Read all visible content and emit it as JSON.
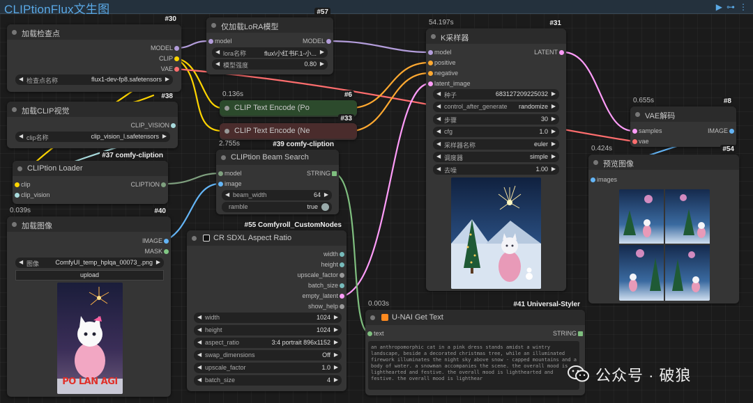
{
  "app": {
    "title": "CLIPtionFlux文生图"
  },
  "colors": {
    "model": "#b39ddb",
    "clip": "#ffd500",
    "vae": "#ff6e6e",
    "latent": "#ff9cf9",
    "image": "#64b5f6",
    "conditioning": "#ffa931",
    "string": "#7fbf7f",
    "clip_vision": "#a8dadc",
    "mask": "#81c784"
  },
  "nodes": {
    "checkpoint": {
      "id": "#30",
      "title": "加载检查点",
      "outputs": [
        "MODEL",
        "CLIP",
        "VAE"
      ],
      "widget_label": "检查点名称",
      "widget_value": "flux1-dev-fp8.safetensors"
    },
    "lora": {
      "id": "#57",
      "title": "仅加载LoRA模型",
      "input": "model",
      "output": "MODEL",
      "lora_label": "lora名称",
      "lora_value": "flux\\小红书F.1-小...",
      "strength_label": "模型强度",
      "strength_value": "0.80"
    },
    "ksampler": {
      "id": "#31",
      "time": "54.197s",
      "title": "K采样器",
      "inputs": [
        "model",
        "positive",
        "negative",
        "latent_image"
      ],
      "output": "LATENT",
      "widgets": [
        {
          "label": "种子",
          "value": "683127209225032"
        },
        {
          "label": "control_after_generate",
          "value": "randomize"
        },
        {
          "label": "步骤",
          "value": "30"
        },
        {
          "label": "cfg",
          "value": "1.0"
        },
        {
          "label": "采样器名称",
          "value": "euler"
        },
        {
          "label": "调度器",
          "value": "simple"
        },
        {
          "label": "去噪",
          "value": "1.00"
        }
      ]
    },
    "clipvision": {
      "id": "#38",
      "title": "加载CLIP视觉",
      "output": "CLIP_VISION",
      "widget_label": "clip名称",
      "widget_value": "clip_vision_l.safetensors"
    },
    "encode_pos": {
      "id": "#6",
      "time": "0.136s",
      "title": "CLIP Text Encode (Po"
    },
    "encode_neg": {
      "id": "#33",
      "title": "CLIP Text Encode (Ne"
    },
    "clipton_loader": {
      "id": "#37 comfy-cliption",
      "title": "CLIPtion Loader",
      "inputs": [
        "clip",
        "clip_vision"
      ],
      "output": "CLIPTION"
    },
    "beam": {
      "id": "#39 comfy-cliption",
      "time": "2.755s",
      "title": "CLIPtion Beam Search",
      "inputs": [
        "model",
        "image"
      ],
      "output": "STRING",
      "beam_label": "beam_width",
      "beam_value": "64",
      "ramble_label": "ramble",
      "ramble_value": "true"
    },
    "vaedecode": {
      "id": "#8",
      "time": "0.655s",
      "title": "VAE解码",
      "inputs": [
        "samples",
        "vae"
      ],
      "output": "IMAGE"
    },
    "preview": {
      "id": "#54",
      "time": "0.424s",
      "title": "预览图像",
      "input": "images"
    },
    "loadimage": {
      "id": "#40",
      "time": "0.039s",
      "title": "加载图像",
      "outputs": [
        "IMAGE",
        "MASK"
      ],
      "widget_label": "图像",
      "widget_value": "ComfyUI_temp_hplqa_00073_.png",
      "upload_label": "upload",
      "poster_text": "PO LAN AGI"
    },
    "aspect": {
      "id": "#55 Comfyroll_CustomNodes",
      "title": "CR SDXL Aspect Ratio",
      "outputs": [
        "width",
        "height",
        "upscale_factor",
        "batch_size",
        "empty_latent",
        "show_help"
      ],
      "widgets": [
        {
          "label": "width",
          "value": "1024"
        },
        {
          "label": "height",
          "value": "1024"
        },
        {
          "label": "aspect_ratio",
          "value": "3:4 portrait 896x1152"
        },
        {
          "label": "swap_dimensions",
          "value": "Off"
        },
        {
          "label": "upscale_factor",
          "value": "1.0"
        },
        {
          "label": "batch_size",
          "value": "4"
        }
      ]
    },
    "gettext": {
      "id": "#41 Universal-Styler",
      "time": "0.003s",
      "title": "U-NAI Get Text",
      "input": "text",
      "output": "STRING",
      "text": "an anthropomorphic cat in a pink dress stands amidst a wintry landscape, beside a decorated christmas tree, while an illuminated firework illuminates the night sky above snow - capped mountains and a body of water. a snowman accompanies the scene. the overall mood is lighthearted and festive. the overall mood is lighthearted and festive. the overall mood is lighthear"
    }
  },
  "watermark": {
    "text": "公众号 · 破狼",
    "icon": "wechat-icon"
  }
}
